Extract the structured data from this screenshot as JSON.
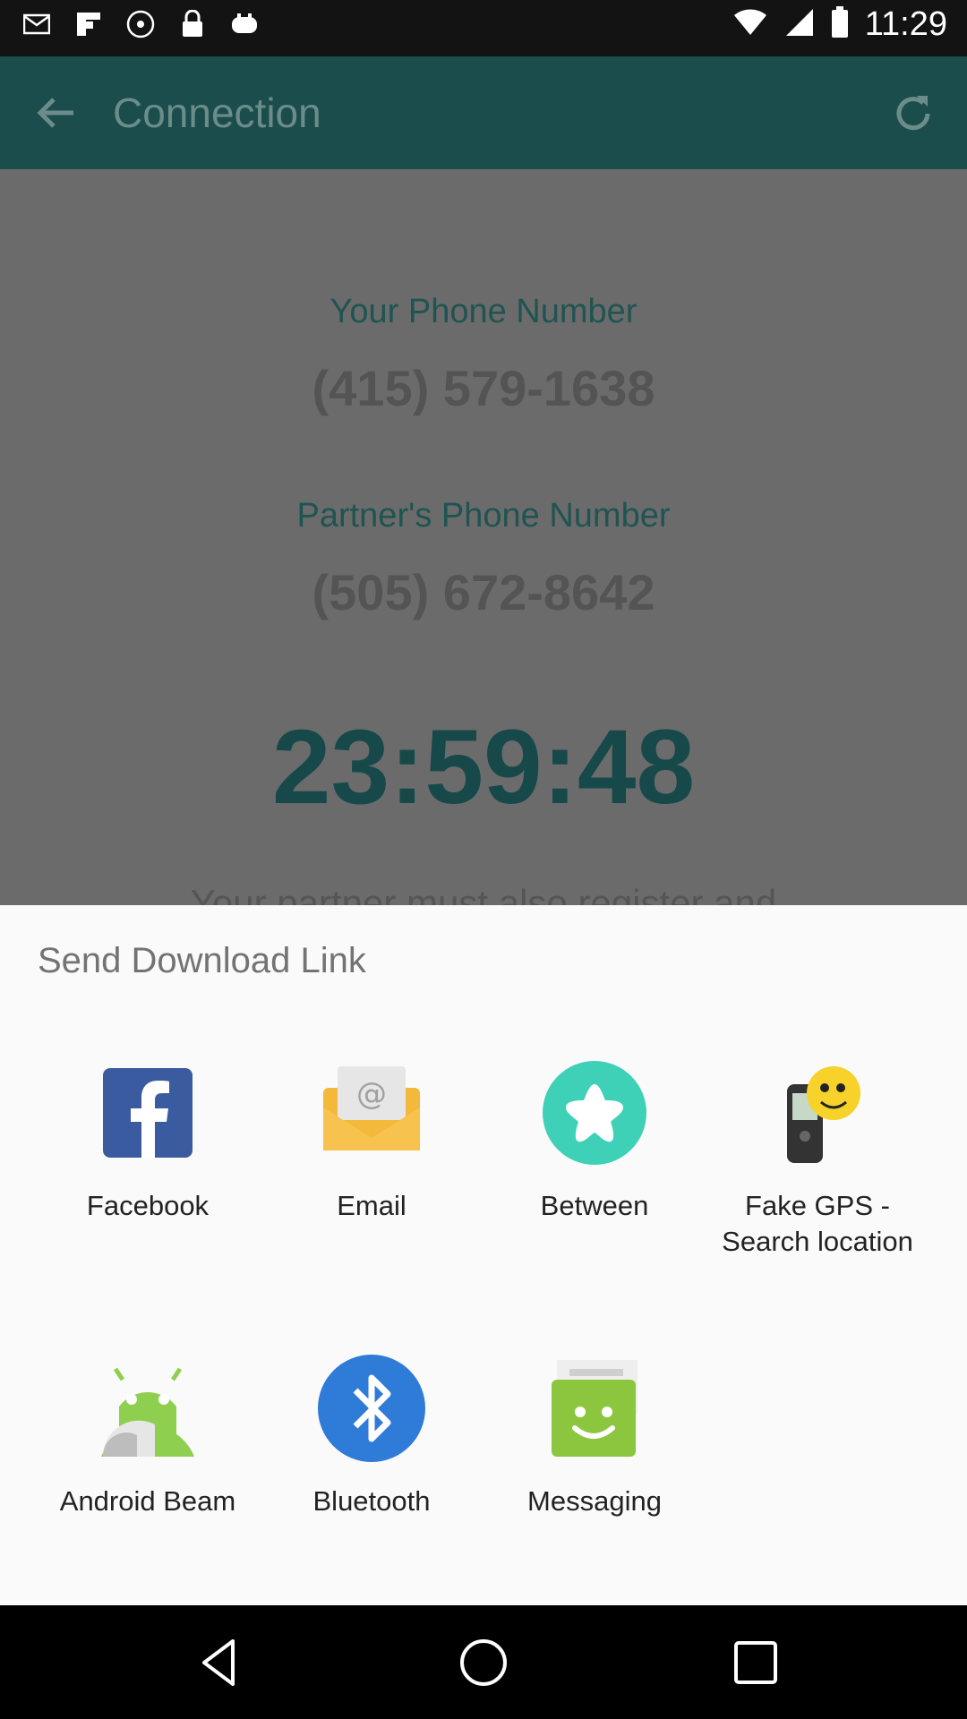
{
  "status_bar": {
    "time": "11:29"
  },
  "app_bar": {
    "title": "Connection"
  },
  "content": {
    "your_phone_label": "Your Phone Number",
    "your_phone_number": "(415) 579-1638",
    "partner_phone_label": "Partner's Phone Number",
    "partner_phone_number": "(505) 672-8642",
    "timer": "23:59:48",
    "partner_note": "Your partner must also register and"
  },
  "share_sheet": {
    "title": "Send Download Link",
    "apps": [
      {
        "label": "Facebook",
        "icon": "facebook-icon"
      },
      {
        "label": "Email",
        "icon": "email-icon"
      },
      {
        "label": "Between",
        "icon": "between-icon"
      },
      {
        "label": "Fake GPS -\nSearch location",
        "icon": "fake-gps-icon"
      },
      {
        "label": "Android Beam",
        "icon": "android-beam-icon"
      },
      {
        "label": "Bluetooth",
        "icon": "bluetooth-icon"
      },
      {
        "label": "Messaging",
        "icon": "messaging-icon"
      }
    ]
  },
  "colors": {
    "app_bar": "#1a4d4c",
    "accent": "#1f5452",
    "sheet_bg": "#fafafa"
  }
}
